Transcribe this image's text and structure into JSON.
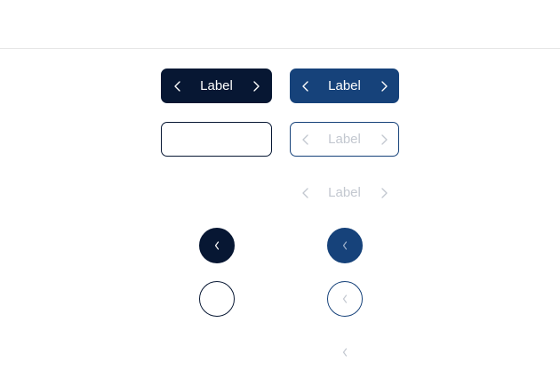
{
  "buttons": {
    "primary_dark": {
      "label": "Label"
    },
    "primary_blue": {
      "label": "Label"
    },
    "outline_dark": {
      "label": ""
    },
    "outline_disabled": {
      "label": "Label"
    },
    "ghost_disabled": {
      "label": "Label"
    }
  },
  "icons": {
    "left": "chevron-left-icon",
    "right": "chevron-right-icon"
  },
  "colors": {
    "navy": "#071733",
    "blue": "#16427a",
    "disabled_text": "#c3c8d0",
    "divider": "#e6e6e6"
  }
}
